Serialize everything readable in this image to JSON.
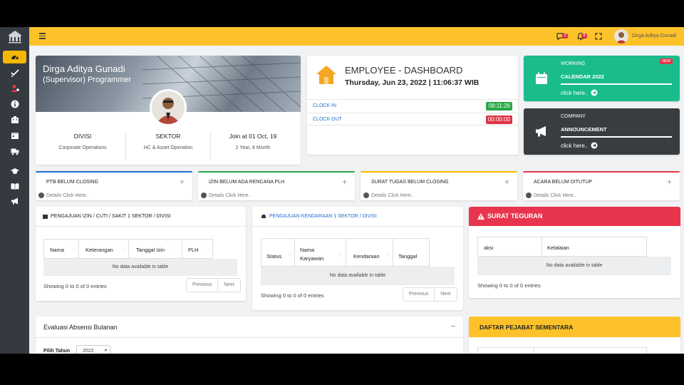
{
  "topbar": {
    "user_name": "Dirga Aditya Gunadi",
    "msg_badge": "3",
    "bell_badge": "8"
  },
  "colors": {
    "accent": "#fdc22a",
    "sidebar": "#343a40",
    "green": "#1abc8c",
    "dark": "#3a3d40",
    "red": "#e8354d",
    "blue": "#1e6fd0"
  },
  "profile": {
    "name": "Dirga Aditya Gunadi",
    "role": "(Supervisor) Programmer",
    "cols": [
      {
        "title": "DIVISI",
        "sub": "Corporate Operations"
      },
      {
        "title": "SEKTOR",
        "sub": "HC & Asset Operation"
      },
      {
        "title": "Join at 01 Oct, 19",
        "sub": "2 Year, 8 Month"
      }
    ]
  },
  "dashboard": {
    "title": "EMPLOYEE - DASHBOARD",
    "datetime": "Thursday, Jun 23, 2022 | 11:06:37 WIB",
    "clock_in_label": "CLOCK IN",
    "clock_in_value": "08:11:26",
    "clock_out_label": "CLOCK OUT",
    "clock_out_value": "00:00:00"
  },
  "tiles": {
    "working": {
      "line1": "WORKING",
      "line2": "CALENDAR 2022",
      "link": "click here..",
      "badge": "NEW"
    },
    "company": {
      "line1": "COMPANY",
      "line2": "ANNOUNCEMENT",
      "link": "click here.."
    }
  },
  "infoboxes": [
    {
      "title": "PTB BELUM CLOSING",
      "detail": "Details Click Here..",
      "color": "#1e6fd0"
    },
    {
      "title": "IZIN BELUM ADA RENCANA PLH",
      "detail": "Details Click Here..",
      "color": "#28a745"
    },
    {
      "title": "SURAT TUGAS BELUM CLOSING",
      "detail": "Details Click Here..",
      "color": "#f5b800"
    },
    {
      "title": "ACARA BELUM DITUTUP",
      "detail": "Details Click Here..",
      "color": "#e8354d"
    }
  ],
  "table1": {
    "title": "PENGAJUAN IZIN / CUTI / SAKIT 1 SEKTOR / DIVISI",
    "columns": [
      "Nama",
      "Keterangan",
      "Tanggal Izin",
      "PLH"
    ],
    "empty": "No data available in table",
    "showing": "Showing 0 to 0 of 0 entries",
    "prev": "Previous",
    "next": "Next"
  },
  "table2": {
    "title": "PENGAJUAN KENDARAAN 1 SEKTOR / DIVISI",
    "columns": [
      "Status",
      "Nama Karyawan",
      "Kendaraan",
      "Tanggal"
    ],
    "empty": "No data available in table",
    "showing": "Showing 0 to 0 of 0 entries",
    "prev": "Previous",
    "next": "Next"
  },
  "table3": {
    "title": "SURAT TEGURAN",
    "columns": [
      "aksi",
      "Kelalaian"
    ],
    "empty": "No data available in table",
    "showing": "Showing 0 to 0 of 0 entries"
  },
  "evaluasi": {
    "title": "Evaluasi Absensi Bulanan",
    "filter_label": "Pilih Tahun",
    "year": "2022"
  },
  "pejabat": {
    "title": "DAFTAR PEJABAT SEMENTARA"
  }
}
